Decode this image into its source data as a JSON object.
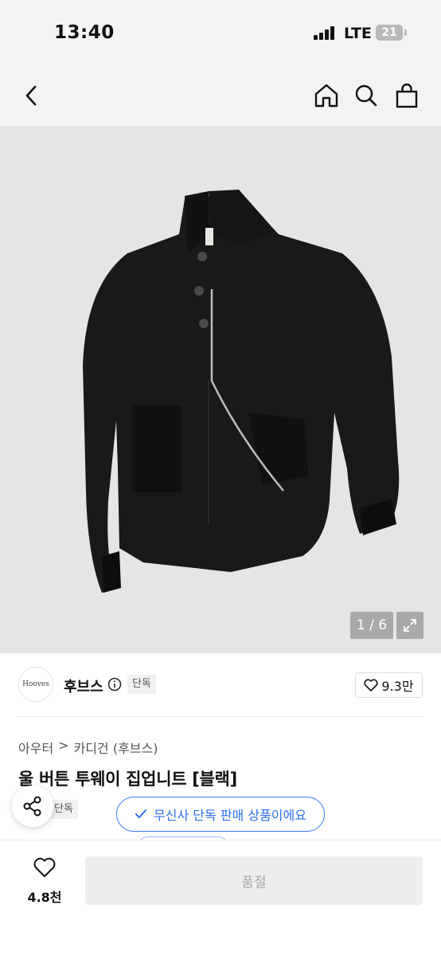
{
  "status_bar": {
    "time": "13:40",
    "network": "LTE",
    "battery": "21"
  },
  "nav": {
    "back_icon": "chevron-left-icon",
    "home_icon": "home-icon",
    "search_icon": "search-icon",
    "cart_icon": "shopping-bag-icon"
  },
  "gallery": {
    "counter": "1 / 6",
    "expand_icon": "expand-icon"
  },
  "brand": {
    "logo_text": "Hooves",
    "name": "후브스",
    "badge": "단독",
    "likes": "9.3만"
  },
  "breadcrumb": {
    "category": "아우터",
    "separator": ">",
    "subcategory": "카디건 (후브스)"
  },
  "product": {
    "title": "울 버튼 투웨이 집업니트 [블랙]",
    "badge": "단독"
  },
  "notice": {
    "text": "무신사 단독 판매 상품이에요"
  },
  "bottom_bar": {
    "wish_count": "4.8천",
    "buy_label": "품절"
  },
  "colors": {
    "accent_blue": "#2d6fe8",
    "photo_bg": "#e5e5e5",
    "soldout_bg": "#eeeeee"
  }
}
